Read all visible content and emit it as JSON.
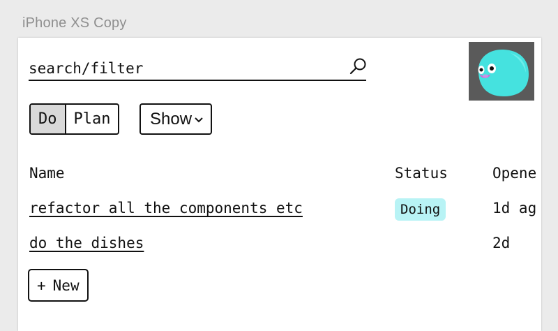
{
  "artboard": {
    "title": "iPhone XS Copy"
  },
  "search": {
    "placeholder": "search/filter"
  },
  "view_toggle": {
    "do_label": "Do",
    "plan_label": "Plan",
    "active": "Do"
  },
  "show_dropdown": {
    "label": "Show"
  },
  "table": {
    "headers": {
      "name": "Name",
      "status": "Status",
      "opened": "Opene"
    },
    "rows": [
      {
        "name": "refactor all the components etc",
        "status": "Doing",
        "opened": "1d ag"
      },
      {
        "name": "do the dishes",
        "status": "",
        "opened": "2d"
      }
    ]
  },
  "new_button": {
    "plus": "+",
    "label": "New"
  },
  "colors": {
    "status_doing": "#b8f3f5",
    "active_segment": "#d9d9d9",
    "avatar_blob": "#45e2df"
  },
  "icons": {
    "search": "search-icon",
    "dropdown": "chevron-down-icon",
    "avatar": "avatar-image"
  }
}
